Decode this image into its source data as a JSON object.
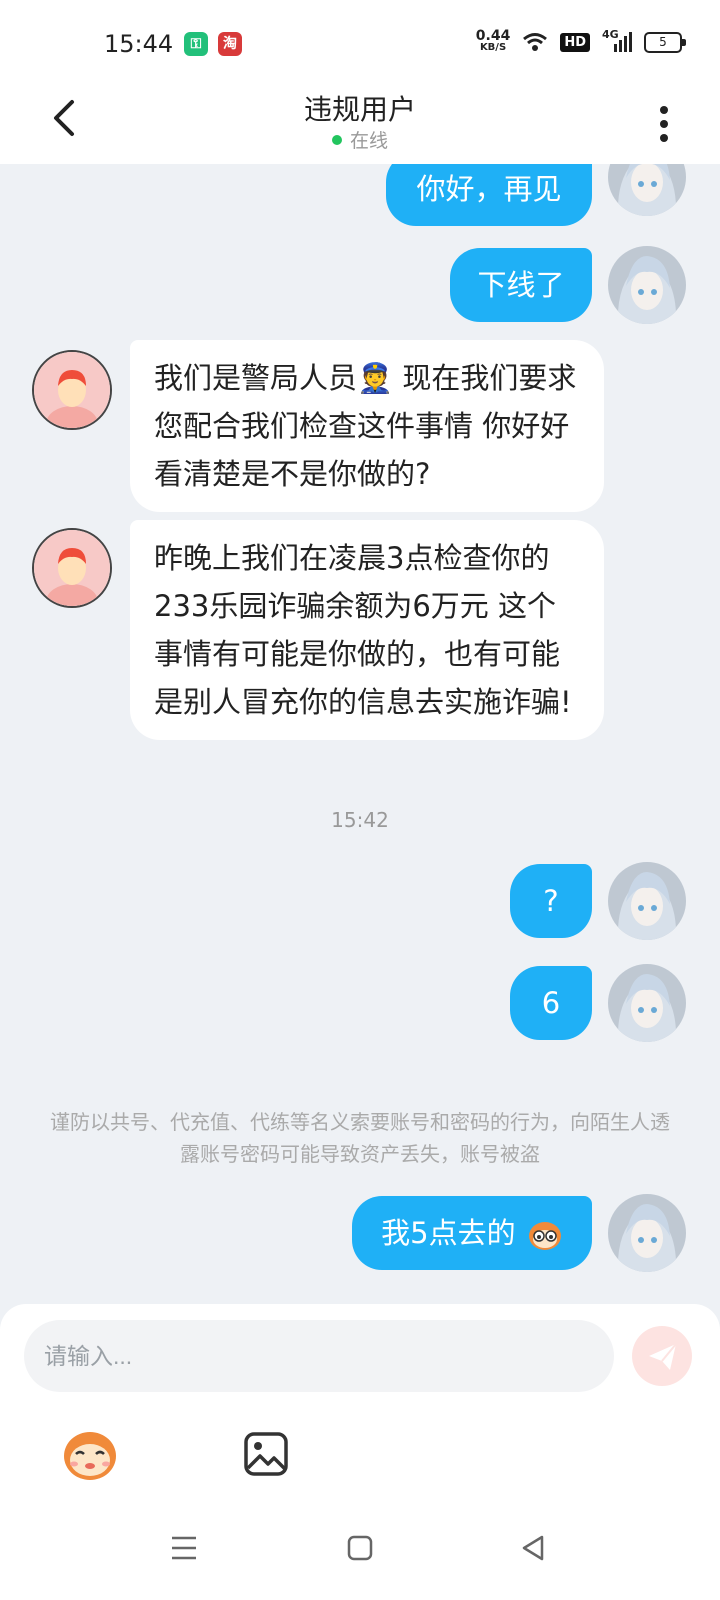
{
  "status_bar": {
    "time": "15:44",
    "app_a": "⚿",
    "app_b": "淘",
    "net_value": "0.44",
    "net_unit": "KB/S",
    "hd": "HD",
    "signal": "4G",
    "battery": "5"
  },
  "header": {
    "title": "违规用户",
    "status": "在线"
  },
  "messages": [
    {
      "side": "out",
      "text": "你好，再见"
    },
    {
      "side": "out",
      "text": "下线了"
    },
    {
      "side": "in",
      "text": "我们是警局人员👮 现在我们要求您配合我们检查这件事情 你好好看清楚是不是你做的?"
    },
    {
      "side": "in",
      "text": "昨晚上我们在凌晨3点检查你的233乐园诈骗余额为6万元 这个事情有可能是你做的，也有可能是别人冒充你的信息去实施诈骗!"
    },
    {
      "side": "out",
      "text": "?"
    },
    {
      "side": "out",
      "text": "6"
    },
    {
      "side": "out",
      "text": "我5点去的"
    }
  ],
  "time_divider": "15:42",
  "notice": "谨防以共号、代充值、代练等名义索要账号和密码的行为，向陌生人透露账号密码可能导致资产丢失，账号被盗",
  "composer": {
    "placeholder": "请输入..."
  },
  "colors": {
    "outgoing_bubble": "#1fb0f6",
    "incoming_bubble": "#ffffff",
    "online": "#22c55e"
  }
}
